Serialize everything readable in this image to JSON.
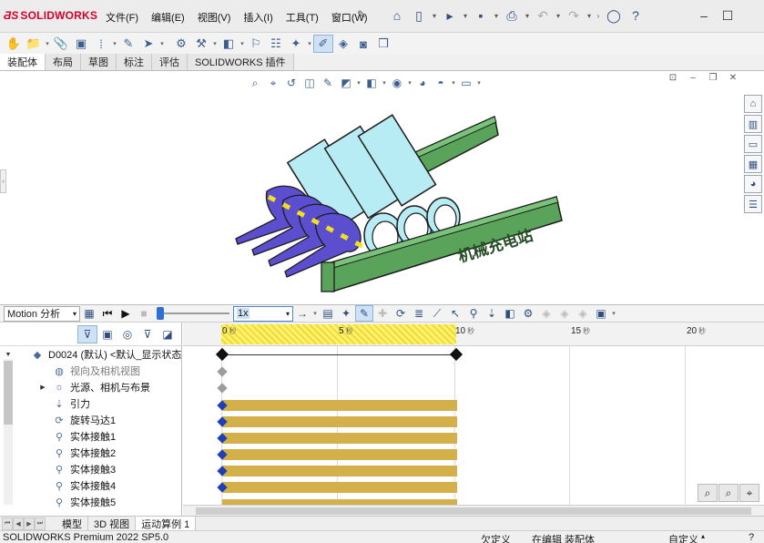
{
  "app": {
    "logo": "SOLIDWORKS",
    "menu": [
      "文件(F)",
      "编辑(E)",
      "视图(V)",
      "插入(I)",
      "工具(T)",
      "窗口(W)"
    ]
  },
  "tabs": [
    {
      "label": "装配体",
      "active": true
    },
    {
      "label": "布局",
      "active": false
    },
    {
      "label": "草图",
      "active": false
    },
    {
      "label": "标注",
      "active": false
    },
    {
      "label": "评估",
      "active": false
    },
    {
      "label": "SOLIDWORKS 插件",
      "active": false
    }
  ],
  "model": {
    "watermark": "机械充电站",
    "colors": {
      "roller": "#b8ecf4",
      "frame": "#5aa35a",
      "claw": "#5b4fcf",
      "axle": "#f0e020"
    }
  },
  "motion": {
    "study_type": "Motion 分析",
    "speed": "1x",
    "playback_position_fraction": 0.0
  },
  "tree": {
    "root": "D0024 (默认) <默认_显示状态",
    "items": [
      {
        "label": "视向及相机视图",
        "icon": "camera-icon",
        "dim": true,
        "expandable": false
      },
      {
        "label": "光源、相机与布景",
        "icon": "lights-icon",
        "dim": false,
        "expandable": true
      },
      {
        "label": "引力",
        "icon": "gravity-icon",
        "dim": false,
        "expandable": false
      },
      {
        "label": "旋转马达1",
        "icon": "motor-icon",
        "dim": false,
        "expandable": false
      },
      {
        "label": "实体接触1",
        "icon": "contact-icon",
        "dim": false,
        "expandable": false
      },
      {
        "label": "实体接触2",
        "icon": "contact-icon",
        "dim": false,
        "expandable": false
      },
      {
        "label": "实体接触3",
        "icon": "contact-icon",
        "dim": false,
        "expandable": false
      },
      {
        "label": "实体接触4",
        "icon": "contact-icon",
        "dim": false,
        "expandable": false
      },
      {
        "label": "实体接触5",
        "icon": "contact-icon",
        "dim": false,
        "expandable": false
      }
    ]
  },
  "timeline": {
    "ticks": [
      {
        "label": "0",
        "seconds": 0
      },
      {
        "label": "5",
        "seconds": 5
      },
      {
        "label": "10",
        "seconds": 10
      },
      {
        "label": "15",
        "seconds": 15
      },
      {
        "label": "20",
        "seconds": 20
      }
    ],
    "duration_seconds": 10,
    "bar_color": "#d4b04a"
  },
  "bottom_tabs": [
    {
      "label": "模型",
      "active": false
    },
    {
      "label": "3D 视图",
      "active": false
    },
    {
      "label": "运动算例 1",
      "active": true
    }
  ],
  "status": {
    "product": "SOLIDWORKS Premium 2022 SP5.0",
    "undefined": "欠定义",
    "editing": "在编辑 装配体",
    "custom": "自定义"
  }
}
